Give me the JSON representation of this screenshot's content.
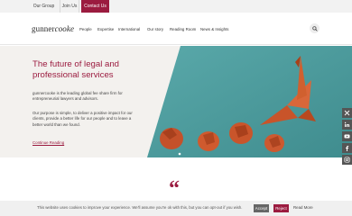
{
  "topbar": {
    "our_group": "Our Group",
    "join_us": "Join Us",
    "contact_us": "Contact Us"
  },
  "header": {
    "logo_text_plain": "gunner",
    "logo_text_italic": "cooke",
    "nav": [
      "People",
      "Expertise",
      "International",
      "Our story",
      "Reading Room",
      "News & Insights"
    ],
    "search_icon": "search-icon"
  },
  "hero": {
    "title": "The future of legal and professional services",
    "para1": "gunnercooke is the leading global fee share firm for entrepreneurial lawyers and advisors.",
    "para2": "Our purpose is simple, to deliver a positive impact for our clients, provide a better life for our people and to leave a better world than we found.",
    "link": "Continue Reading"
  },
  "social": {
    "icons": [
      "twitter-icon",
      "linkedin-icon",
      "youtube-icon",
      "facebook-icon",
      "instagram-icon"
    ]
  },
  "quote_mark": "“",
  "cookie": {
    "text": "This website uses cookies to improve your experience. We'll assume you're ok with this, but you can opt-out if you wish.",
    "accept": "Accept",
    "reject": "Reject",
    "read_more": "Read More"
  },
  "colors": {
    "brand": "#9b1b3f",
    "teal": "#4f9fa0",
    "origami": "#c8542a"
  }
}
